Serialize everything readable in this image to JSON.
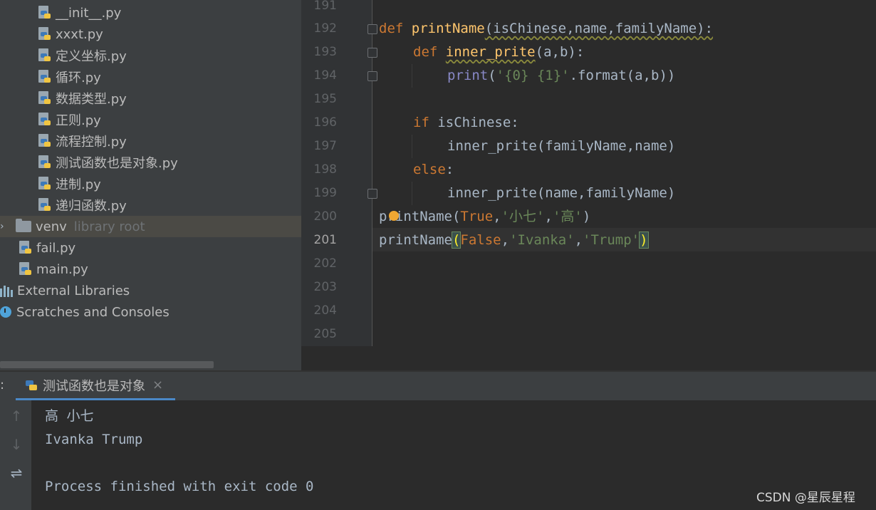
{
  "project_tree": {
    "files": [
      {
        "name": "__init__.py",
        "type": "python"
      },
      {
        "name": "xxxt.py",
        "type": "python"
      },
      {
        "name": "定义坐标.py",
        "type": "python"
      },
      {
        "name": "循环.py",
        "type": "python"
      },
      {
        "name": "数据类型.py",
        "type": "python"
      },
      {
        "name": "正则.py",
        "type": "python"
      },
      {
        "name": "流程控制.py",
        "type": "python"
      },
      {
        "name": "测试函数也是对象.py",
        "type": "python"
      },
      {
        "name": "进制.py",
        "type": "python"
      },
      {
        "name": "递归函数.py",
        "type": "python"
      }
    ],
    "venv": {
      "name": "venv",
      "hint": "library root"
    },
    "root_files": [
      {
        "name": "fail.py"
      },
      {
        "name": "main.py"
      }
    ],
    "external_libraries": "External Libraries",
    "scratches": "Scratches and Consoles"
  },
  "editor": {
    "line_numbers": [
      "191",
      "192",
      "193",
      "194",
      "195",
      "196",
      "197",
      "198",
      "199",
      "200",
      "201",
      "202",
      "203",
      "204",
      "205"
    ],
    "current_line": "201",
    "code": {
      "l192": {
        "kw": "def",
        "fn": "printName",
        "rest": "(isChinese,name,familyName):"
      },
      "l193": {
        "kw": "def",
        "fn": "inner_prite",
        "rest": "(a,b):"
      },
      "l194": {
        "bi": "print",
        "p1": "(",
        "str": "'{0} {1}'",
        "rest": ".format(a,b))"
      },
      "l196": {
        "kw": "if",
        "rest": " isChinese:"
      },
      "l197": {
        "text": "inner_prite(familyName,name)"
      },
      "l198": {
        "kw": "else",
        "rest": ":"
      },
      "l199": {
        "text": "inner_prite(name,familyName)"
      },
      "l200": {
        "pre": "printName(",
        "kw": "True",
        "s1": "'小七'",
        "s2": "'高'",
        "close": ")"
      },
      "l201": {
        "pre": "printName",
        "open": "(",
        "kw": "False",
        "s1": "'Ivanka'",
        "s2": "'Trump'",
        "close": ")"
      }
    }
  },
  "run_panel": {
    "colon": ":",
    "tab_label": "测试函数也是对象",
    "tab_close": "×",
    "output": [
      "高 小七",
      "Ivanka Trump",
      "",
      "Process finished with exit code 0"
    ]
  },
  "watermark": "CSDN @星辰星程",
  "colors": {
    "keyword": "#cc7832",
    "function": "#ffc66d",
    "string": "#6a8759",
    "builtin": "#8888c6",
    "accent": "#4a88c7"
  }
}
